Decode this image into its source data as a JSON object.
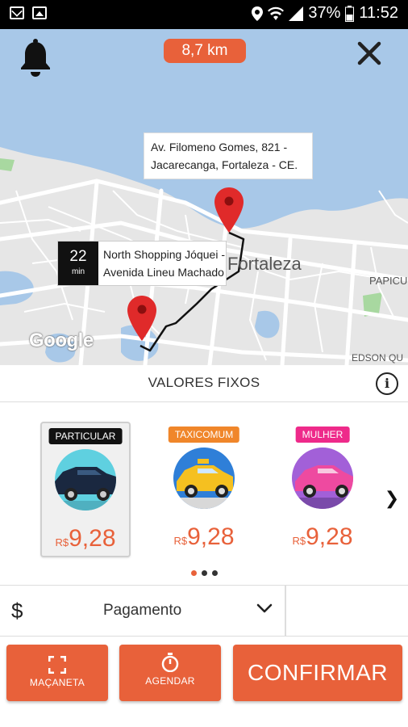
{
  "status_bar": {
    "battery_percent": "37%",
    "time": "11:52",
    "left_icons": [
      "mail-icon",
      "image-icon"
    ],
    "right_icons": [
      "location-icon",
      "wifi-icon",
      "signal-icon",
      "battery-icon"
    ]
  },
  "map": {
    "distance": "8,7 km",
    "destination_address": "Av. Filomeno Gomes, 821 - Jacarecanga, Fortaleza - CE.",
    "origin_eta_value": "22",
    "origin_eta_unit": "min",
    "origin_address_line1": "North Shopping Jóquei -",
    "origin_address_line2": "Avenida Lineu Machado -",
    "city_label": "Fortaleza",
    "neighborhood_label_1": "PAPICU",
    "neighborhood_label_2": "EDSON QU",
    "attribution": "Google",
    "colors": {
      "water": "#a8c8e8",
      "land": "#e6e6e6",
      "road": "#ffffff",
      "pin": "#e02a2a",
      "route": "#000000"
    }
  },
  "fixed_prices": {
    "title": "VALORES FIXOS",
    "info_icon": "info-icon"
  },
  "options": [
    {
      "tag": "PARTICULAR",
      "tag_color": "#111111",
      "currency": "R$",
      "price": "9,28",
      "selected": true,
      "image": "dark-car",
      "circle_color": "#5fd0e0"
    },
    {
      "tag": "TAXICOMUM",
      "tag_color": "#f0862a",
      "currency": "R$",
      "price": "9,28",
      "selected": false,
      "image": "yellow-taxi",
      "circle_color": "#2f7fd8"
    },
    {
      "tag": "MULHER",
      "tag_color": "#ee2a8a",
      "currency": "R$",
      "price": "9,28",
      "selected": false,
      "image": "pink-car",
      "circle_color": "#a260d8"
    }
  ],
  "carousel": {
    "pages": 3,
    "active": 0
  },
  "payment": {
    "icon": "dollar-icon",
    "symbol": "$",
    "label": "Pagamento"
  },
  "actions": {
    "door_label": "MAÇANETA",
    "schedule_label": "AGENDAR",
    "confirm_label": "CONFIRMAR"
  },
  "accent_color": "#e8613a"
}
